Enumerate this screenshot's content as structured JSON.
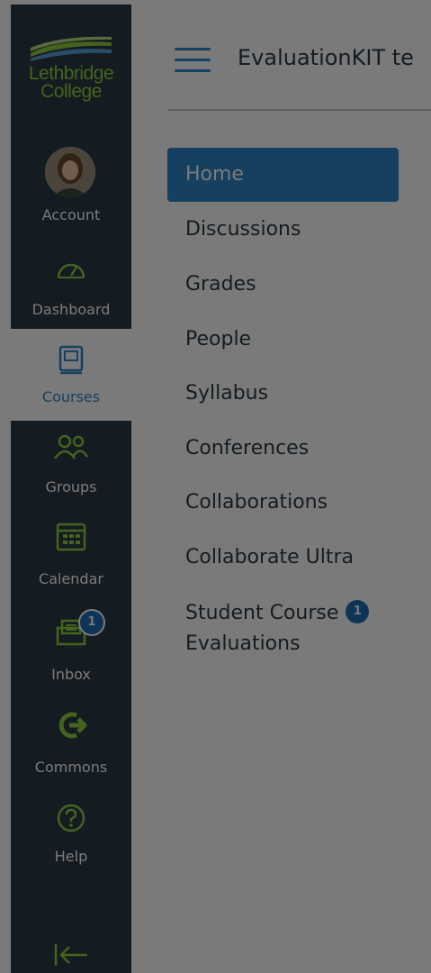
{
  "logo": {
    "line1": "Lethbridge",
    "line2": "College"
  },
  "global_nav": {
    "account": "Account",
    "dashboard": "Dashboard",
    "courses": "Courses",
    "groups": "Groups",
    "calendar": "Calendar",
    "inbox": "Inbox",
    "inbox_badge": "1",
    "commons": "Commons",
    "help": "Help"
  },
  "header": {
    "course_title": "EvaluationKIT te"
  },
  "course_nav": {
    "items": [
      {
        "label": "Home"
      },
      {
        "label": "Discussions"
      },
      {
        "label": "Grades"
      },
      {
        "label": "People"
      },
      {
        "label": "Syllabus"
      },
      {
        "label": "Conferences"
      },
      {
        "label": "Collaborations"
      },
      {
        "label": "Collaborate Ultra"
      },
      {
        "label": "Student Course",
        "label_line2": "Evaluations",
        "badge": "1"
      }
    ]
  },
  "colors": {
    "nav_bg": "#2d3b45",
    "brand_green": "#8ccf3f",
    "accent_blue": "#2f87c9",
    "badge_blue": "#1e6fb8"
  },
  "icons": {
    "account": "avatar-photo",
    "dashboard": "speedometer-icon",
    "courses": "book-icon",
    "groups": "people-icon",
    "calendar": "calendar-icon",
    "inbox": "inbox-icon",
    "commons": "arrow-right-circle-icon",
    "help": "question-circle-icon",
    "collapse": "collapse-arrow-icon",
    "menu": "hamburger-icon"
  }
}
